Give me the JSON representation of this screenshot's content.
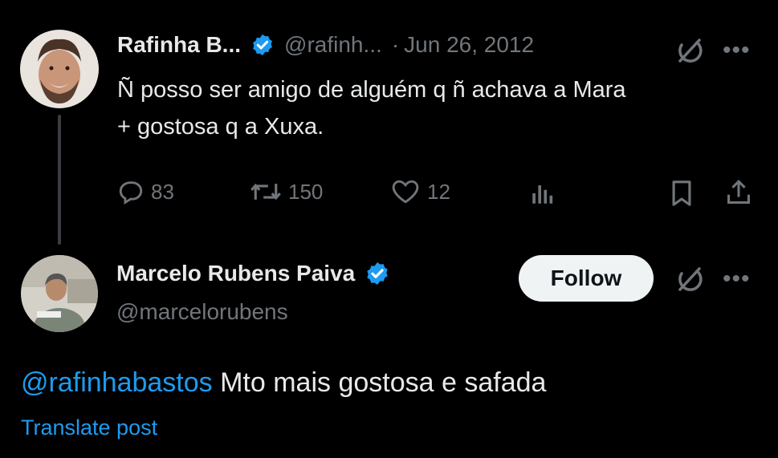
{
  "tweet1": {
    "display_name": "Rafinha B...",
    "handle": "@rafinh...",
    "separator": "·",
    "date": "Jun 26, 2012",
    "text_line1": "Ñ posso ser amigo de alguém q ñ achava a Mara",
    "text_line2": "+ gostosa q a Xuxa.",
    "metrics": {
      "replies": "83",
      "reposts": "150",
      "likes": "12"
    },
    "more_label": "•••"
  },
  "tweet2": {
    "display_name": "Marcelo Rubens Paiva",
    "handle": "@marcelorubens",
    "follow_label": "Follow",
    "more_label": "•••",
    "mention": "@rafinhabastos",
    "text": " Mto mais gostosa e safada",
    "translate_label": "Translate post"
  },
  "colors": {
    "background": "#000000",
    "text": "#e7e9ea",
    "muted": "#71767b",
    "accent": "#1d9bf0",
    "verified": "#1d9bf0"
  },
  "icons": [
    "verified-badge-icon",
    "grok-icon",
    "more-icon",
    "reply-icon",
    "repost-icon",
    "like-icon",
    "views-icon",
    "bookmark-icon",
    "share-icon"
  ]
}
